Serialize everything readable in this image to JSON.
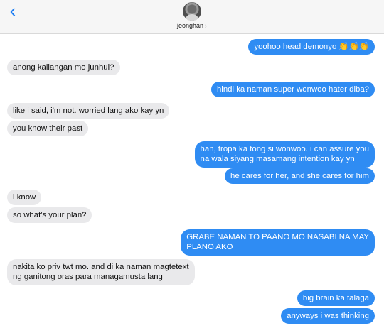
{
  "header": {
    "back_icon": "chevron-left-icon",
    "contact_name": "jeonghan",
    "contact_chevron": "›"
  },
  "messages": [
    {
      "direction": "out",
      "text": "yoohoo head demonyo 👏👏👏"
    },
    {
      "direction": "in",
      "text": "anong kailangan mo junhui?"
    },
    {
      "direction": "out",
      "text": "hindi ka naman super wonwoo hater diba?"
    },
    {
      "direction": "in",
      "text": "like i said, i'm not. worried lang ako kay yn"
    },
    {
      "direction": "in",
      "text": "you know their past"
    },
    {
      "direction": "out",
      "lines": [
        "han, tropa ka tong si wonwoo. i can assure you",
        "na wala siyang masamang intention kay yn"
      ]
    },
    {
      "direction": "out",
      "text": "he cares for her, and she cares for him"
    },
    {
      "direction": "in",
      "text": "i know"
    },
    {
      "direction": "in",
      "text": "so what's your plan?"
    },
    {
      "direction": "out",
      "lines": [
        "GRABE NAMAN TO PAANO MO NASABI NA MAY",
        "PLANO AKO"
      ]
    },
    {
      "direction": "in",
      "lines": [
        "nakita ko priv twt mo. and di ka naman magtetext",
        "ng ganitong oras para managamusta lang"
      ]
    },
    {
      "direction": "out",
      "text": "big brain ka talaga"
    },
    {
      "direction": "out",
      "text": "anyways i was thinking"
    }
  ],
  "colors": {
    "outgoing": "#2f8cf3",
    "incoming": "#e9e9eb",
    "accent": "#1a7cf3"
  }
}
